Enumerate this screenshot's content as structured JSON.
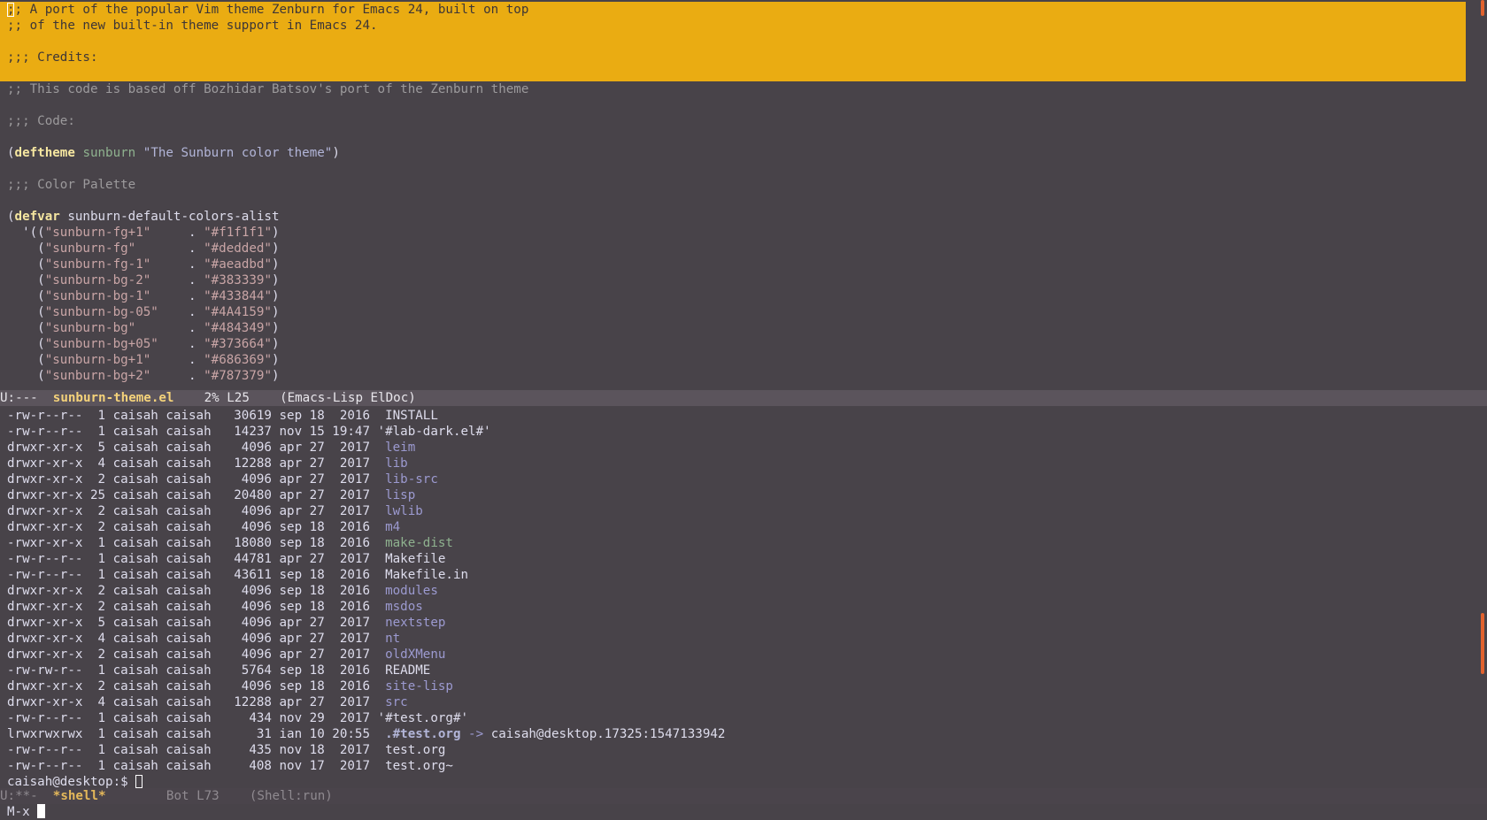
{
  "colors": {
    "background": "#484349",
    "highlight": "#eaac12",
    "modeline_active": "#5b545c",
    "modeline_inactive": "#4a444b",
    "scroll_thumb": "#e1622e"
  },
  "editor": {
    "header_comment": [
      ";; A port of the popular Vim theme Zenburn for Emacs 24, built on top",
      ";; of the new built-in theme support in Emacs 24.",
      "",
      ";;; Credits:"
    ],
    "credits_comment": ";; This code is based off Bozhidar Batsov's port of the Zenburn theme",
    "code_comment": ";;; Code:",
    "deftheme": {
      "open": "(",
      "keyword": "deftheme",
      "name": "sunburn",
      "doc": "\"The Sunburn color theme\"",
      "close": ")"
    },
    "palette_comment": ";;; Color Palette",
    "defvar": {
      "open": "(",
      "keyword": "defvar",
      "name": "sunburn-default-colors-alist"
    },
    "colors_alist": [
      {
        "prefix": "  '((",
        "name": "\"sunburn-fg+1\"",
        "pad": "     . ",
        "value": "\"#f1f1f1\"",
        "suffix": ")"
      },
      {
        "prefix": "    (",
        "name": "\"sunburn-fg\"",
        "pad": "       . ",
        "value": "\"#dedded\"",
        "suffix": ")"
      },
      {
        "prefix": "    (",
        "name": "\"sunburn-fg-1\"",
        "pad": "     . ",
        "value": "\"#aeadbd\"",
        "suffix": ")"
      },
      {
        "prefix": "    (",
        "name": "\"sunburn-bg-2\"",
        "pad": "     . ",
        "value": "\"#383339\"",
        "suffix": ")"
      },
      {
        "prefix": "    (",
        "name": "\"sunburn-bg-1\"",
        "pad": "     . ",
        "value": "\"#433844\"",
        "suffix": ")"
      },
      {
        "prefix": "    (",
        "name": "\"sunburn-bg-05\"",
        "pad": "    . ",
        "value": "\"#4A4159\"",
        "suffix": ")"
      },
      {
        "prefix": "    (",
        "name": "\"sunburn-bg\"",
        "pad": "       . ",
        "value": "\"#484349\"",
        "suffix": ")"
      },
      {
        "prefix": "    (",
        "name": "\"sunburn-bg+05\"",
        "pad": "    . ",
        "value": "\"#373664\"",
        "suffix": ")"
      },
      {
        "prefix": "    (",
        "name": "\"sunburn-bg+1\"",
        "pad": "     . ",
        "value": "\"#686369\"",
        "suffix": ")"
      },
      {
        "prefix": "    (",
        "name": "\"sunburn-bg+2\"",
        "pad": "     . ",
        "value": "\"#787379\"",
        "suffix": ")"
      }
    ]
  },
  "modeline_top": {
    "status": "U:---  ",
    "buffer": "sunburn-theme.el",
    "position": "    2% L25    ",
    "mode": "(Emacs-Lisp ElDoc)"
  },
  "shell": {
    "listing": [
      {
        "meta": "-rw-r--r--  1 caisah caisah   30619 sep 18  2016  ",
        "name": "INSTALL",
        "kind": "file"
      },
      {
        "meta": "-rw-r--r--  1 caisah caisah   14237 nov 15 19:47 ",
        "name": "'#lab-dark.el#'",
        "kind": "file"
      },
      {
        "meta": "drwxr-xr-x  5 caisah caisah    4096 apr 27  2017  ",
        "name": "leim",
        "kind": "dir"
      },
      {
        "meta": "drwxr-xr-x  4 caisah caisah   12288 apr 27  2017  ",
        "name": "lib",
        "kind": "dir"
      },
      {
        "meta": "drwxr-xr-x  2 caisah caisah    4096 apr 27  2017  ",
        "name": "lib-src",
        "kind": "dir"
      },
      {
        "meta": "drwxr-xr-x 25 caisah caisah   20480 apr 27  2017  ",
        "name": "lisp",
        "kind": "dir"
      },
      {
        "meta": "drwxr-xr-x  2 caisah caisah    4096 apr 27  2017  ",
        "name": "lwlib",
        "kind": "dir"
      },
      {
        "meta": "drwxr-xr-x  2 caisah caisah    4096 sep 18  2016  ",
        "name": "m4",
        "kind": "dir"
      },
      {
        "meta": "-rwxr-xr-x  1 caisah caisah   18080 sep 18  2016  ",
        "name": "make-dist",
        "kind": "exe"
      },
      {
        "meta": "-rw-r--r--  1 caisah caisah   44781 apr 27  2017  ",
        "name": "Makefile",
        "kind": "file"
      },
      {
        "meta": "-rw-r--r--  1 caisah caisah   43611 sep 18  2016  ",
        "name": "Makefile.in",
        "kind": "file"
      },
      {
        "meta": "drwxr-xr-x  2 caisah caisah    4096 sep 18  2016  ",
        "name": "modules",
        "kind": "dir"
      },
      {
        "meta": "drwxr-xr-x  2 caisah caisah    4096 sep 18  2016  ",
        "name": "msdos",
        "kind": "dir"
      },
      {
        "meta": "drwxr-xr-x  5 caisah caisah    4096 apr 27  2017  ",
        "name": "nextstep",
        "kind": "dir"
      },
      {
        "meta": "drwxr-xr-x  4 caisah caisah    4096 apr 27  2017  ",
        "name": "nt",
        "kind": "dir"
      },
      {
        "meta": "drwxr-xr-x  2 caisah caisah    4096 apr 27  2017  ",
        "name": "oldXMenu",
        "kind": "dir"
      },
      {
        "meta": "-rw-rw-r--  1 caisah caisah    5764 sep 18  2016  ",
        "name": "README",
        "kind": "file"
      },
      {
        "meta": "drwxr-xr-x  2 caisah caisah    4096 sep 18  2016  ",
        "name": "site-lisp",
        "kind": "dir"
      },
      {
        "meta": "drwxr-xr-x  4 caisah caisah   12288 apr 27  2017  ",
        "name": "src",
        "kind": "dir"
      },
      {
        "meta": "-rw-r--r--  1 caisah caisah     434 nov 29  2017 ",
        "name": "'#test.org#'",
        "kind": "file"
      },
      {
        "meta": "lrwxrwxrwx  1 caisah caisah      31 ian 10 20:55  ",
        "name": ".#test.org",
        "kind": "link",
        "arrow": " -> ",
        "target": "caisah@desktop.17325:1547133942"
      },
      {
        "meta": "-rw-r--r--  1 caisah caisah     435 nov 18  2017  ",
        "name": "test.org",
        "kind": "file"
      },
      {
        "meta": "-rw-r--r--  1 caisah caisah     408 nov 17  2017  ",
        "name": "test.org~",
        "kind": "file"
      }
    ],
    "prompt": "caisah@desktop:$ "
  },
  "modeline_bottom": {
    "status": "U:**-  ",
    "buffer": "*shell*",
    "position": "        Bot L73    ",
    "mode": "(Shell:run)"
  },
  "minibuffer": {
    "text": "M-x "
  }
}
